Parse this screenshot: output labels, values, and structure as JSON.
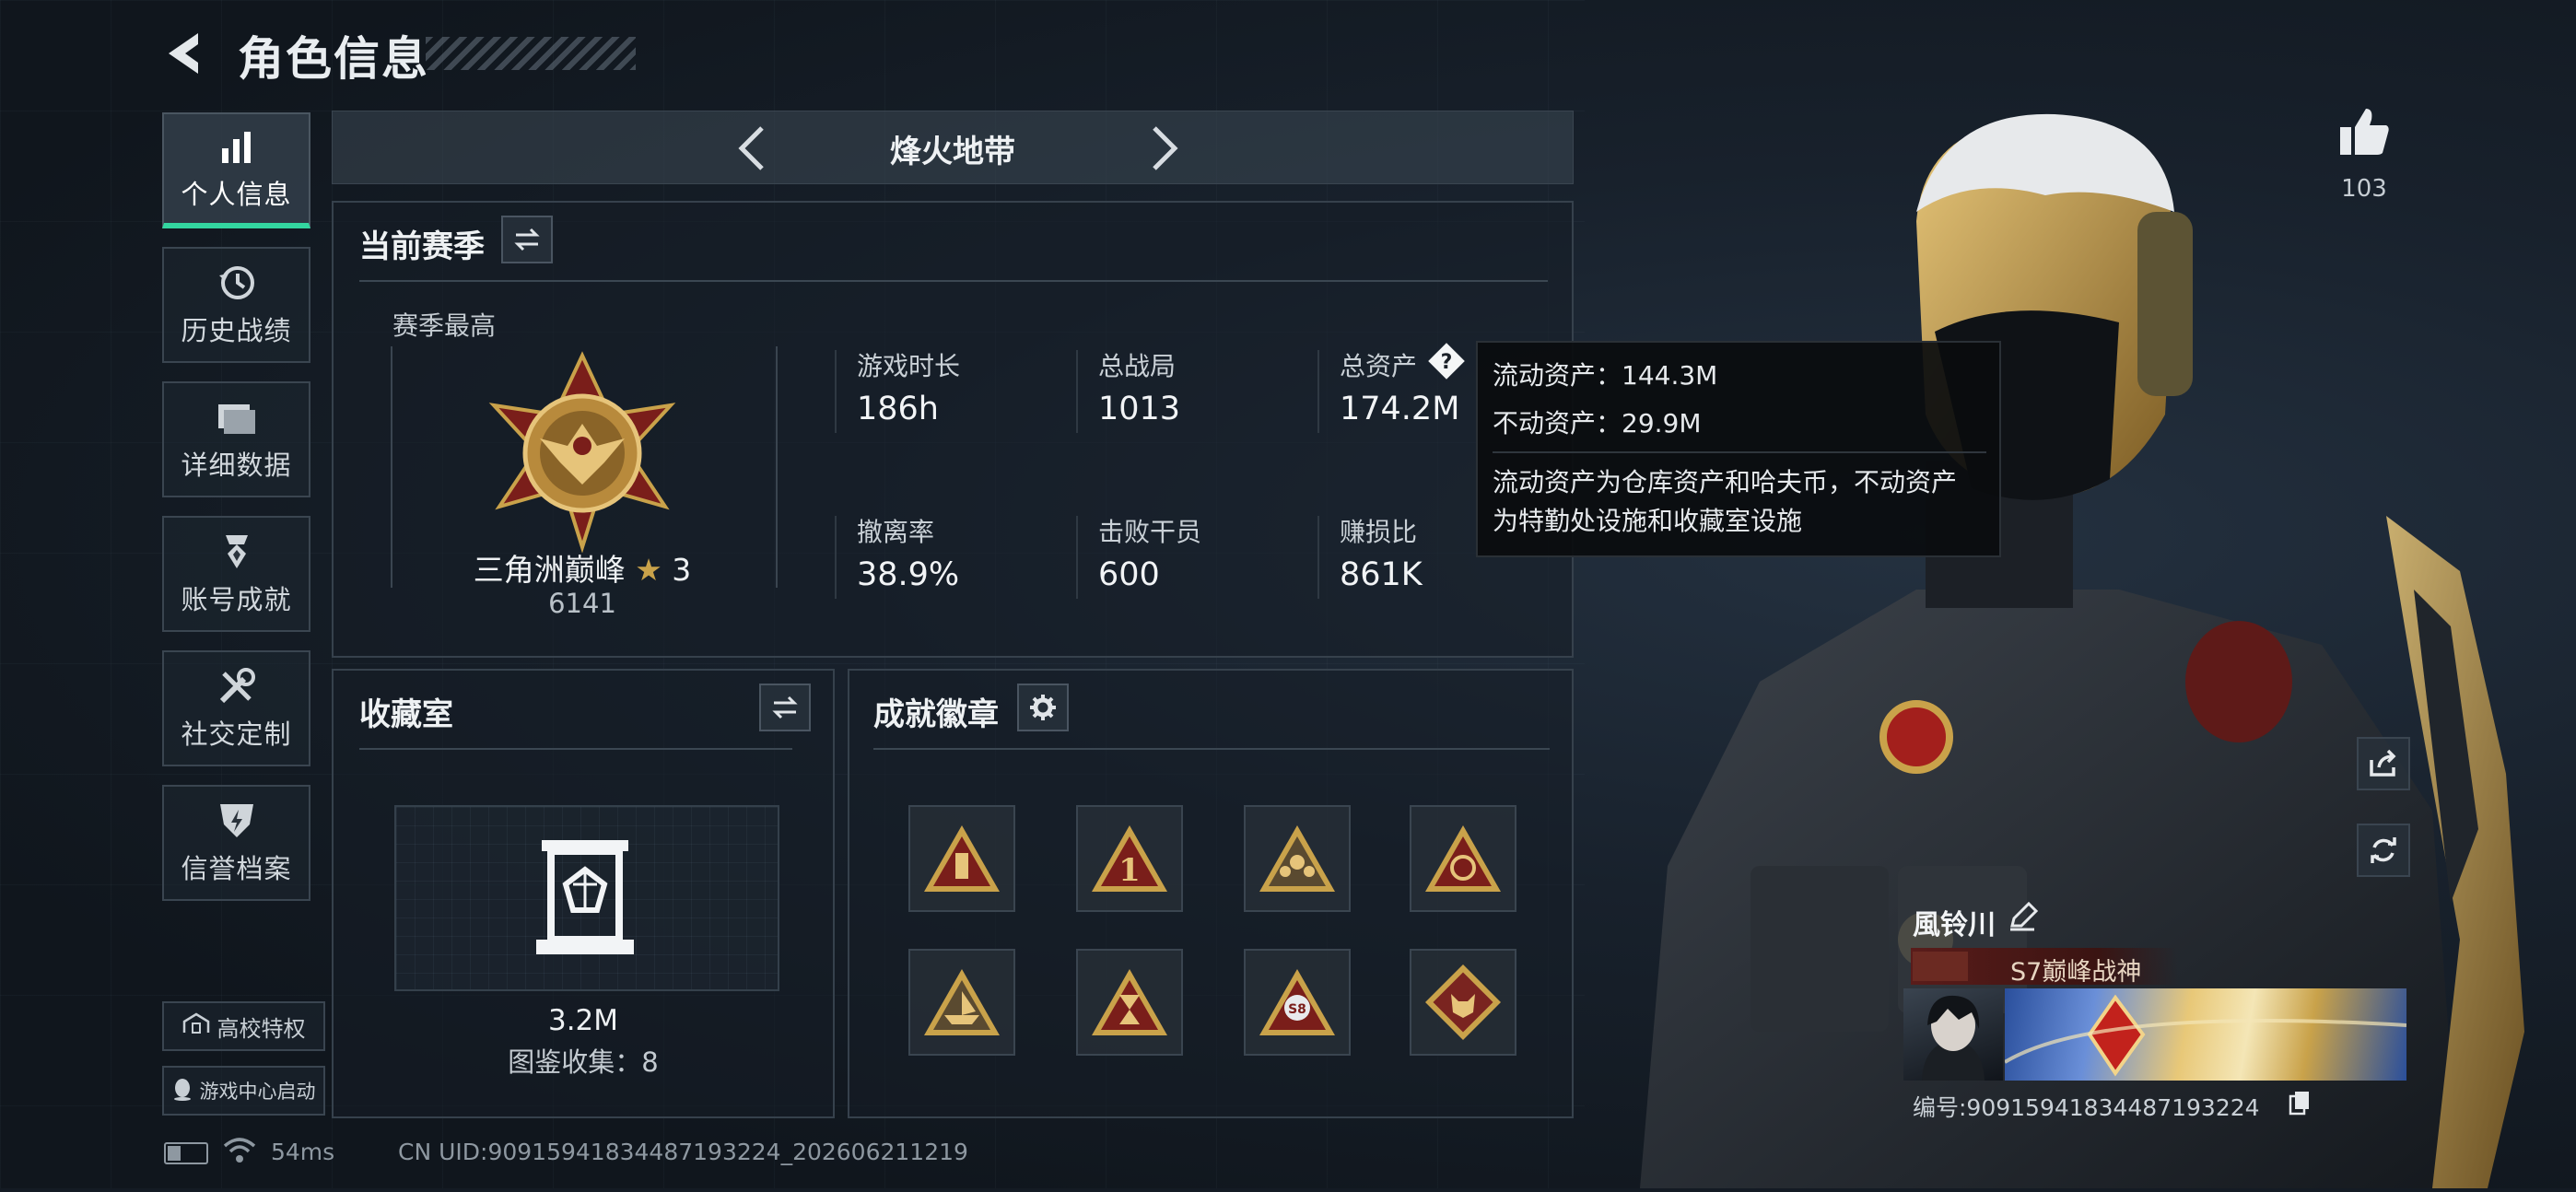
{
  "header": {
    "title": "角色信息"
  },
  "nav": {
    "items": [
      {
        "label": "个人信息",
        "icon": "bar-chart-icon",
        "active": true
      },
      {
        "label": "历史战绩",
        "icon": "history-clock-icon"
      },
      {
        "label": "详细数据",
        "icon": "folder-icon"
      },
      {
        "label": "账号成就",
        "icon": "achievement-medal-icon"
      },
      {
        "label": "社交定制",
        "icon": "tools-icon"
      },
      {
        "label": "信誉档案",
        "icon": "shield-bolt-icon"
      }
    ],
    "campus_label": "高校特权",
    "game_center_label": "游戏中心启动"
  },
  "mode": {
    "title": "烽火地带"
  },
  "season": {
    "title": "当前赛季",
    "best_label": "赛季最高",
    "rank_name": "三角洲巅峰",
    "rank_stars": "3",
    "rank_points": "6141",
    "stats": [
      {
        "label": "游戏时长",
        "value": "186h"
      },
      {
        "label": "总战局",
        "value": "1013"
      },
      {
        "label": "总资产",
        "value": "174.2M"
      },
      {
        "label": "撤离率",
        "value": "38.9%"
      },
      {
        "label": "击败干员",
        "value": "600"
      },
      {
        "label": "赚损比",
        "value": "861K"
      }
    ]
  },
  "tooltip": {
    "liquid": "流动资产：144.3M",
    "fixed": "不动资产：29.9M",
    "note_line1": "流动资产为仓库资产和哈夫币，不动资产",
    "note_line2": "为特勤处设施和收藏室设施"
  },
  "collection": {
    "title": "收藏室",
    "value": "3.2M",
    "count_label": "图鉴收集：8"
  },
  "badges": {
    "title": "成就徽章",
    "items": [
      "bottle-badge-icon",
      "number-one-badge-icon",
      "squad-badge-icon",
      "eye-badge-icon",
      "boat-badge-icon",
      "hourglass-badge-icon",
      "s8-badge-icon",
      "wolf-badge-icon"
    ]
  },
  "likes": {
    "count": "103"
  },
  "player": {
    "name": "風铃川",
    "title": "S7巅峰战神",
    "id_label": "编号:9091594183448719322​4"
  },
  "status": {
    "ping": "54ms",
    "uid": "CN UID:9091594183448719322​4_202606211219"
  },
  "colors": {
    "accent": "#33d6a0",
    "gold": "#c9a24a",
    "badge_red": "#8a2420"
  }
}
